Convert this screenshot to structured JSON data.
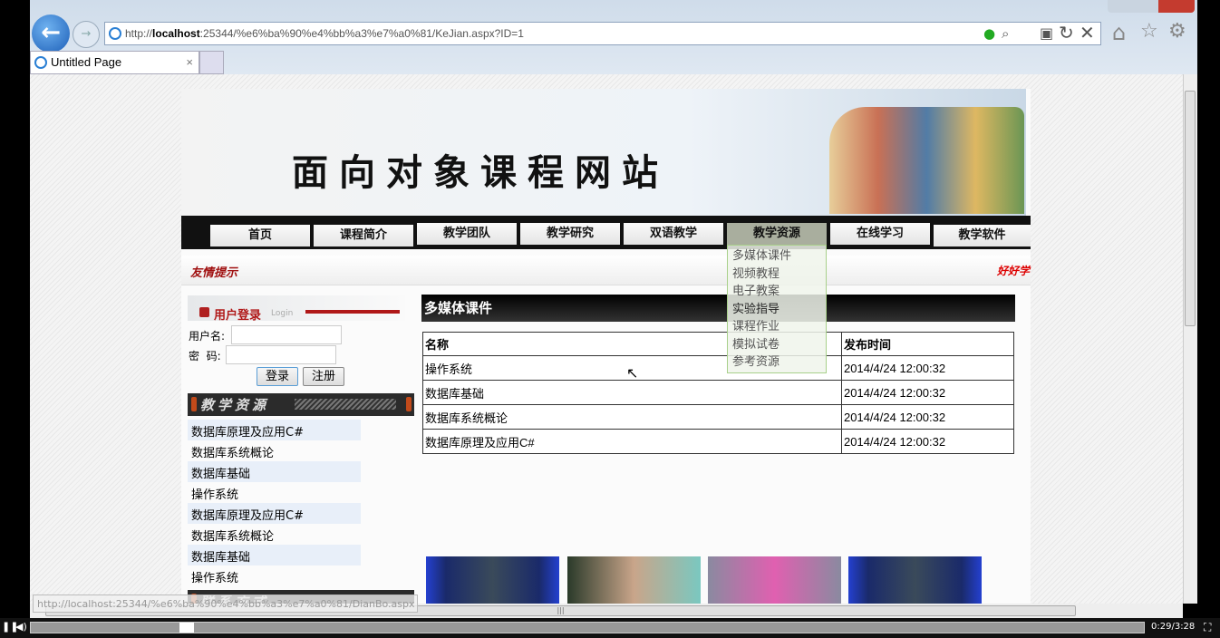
{
  "browser": {
    "url_prefix": "http://",
    "url_host": "localhost",
    "url_rest": ":25344/%e6%ba%90%e4%bb%a3%e7%a0%81/KeJian.aspx?ID=1",
    "tab_title": "Untitled Page",
    "tab_close": "×",
    "status_url": "http://localhost:25344/%e6%ba%90%e4%bb%a3%e7%a0%81/DianBo.aspx"
  },
  "banner": {
    "title": "面向对象课程网站"
  },
  "nav": {
    "items": [
      "首页",
      "课程简介",
      "教学团队",
      "教学研究",
      "双语教学",
      "教学资源",
      "在线学习",
      "教学软件"
    ],
    "active": "教学资源"
  },
  "dropdown": {
    "items": [
      "多媒体课件",
      "视频教程",
      "电子教案",
      "实验指导",
      "课程作业",
      "模拟试卷",
      "参考资源"
    ],
    "highlighted": "实验指导"
  },
  "tip": {
    "left": "友情提示",
    "right": "好好学"
  },
  "login": {
    "title": "用户登录",
    "subtitle": "Login",
    "username_label": "用户名:",
    "password_label": "密  码:",
    "username_value": "",
    "password_value": "",
    "login_button": "登录",
    "register_button": "注册"
  },
  "resources": {
    "title": "教学资源",
    "items": [
      "数据库原理及应用C#",
      "数据库系统概论",
      "数据库基础",
      "操作系统",
      "数据库原理及应用C#",
      "数据库系统概论",
      "数据库基础",
      "操作系统"
    ]
  },
  "contact": {
    "title": "联系方式"
  },
  "main": {
    "title": "多媒体课件",
    "columns": [
      "名称",
      "发布时间"
    ],
    "rows": [
      [
        "操作系统",
        "2014/4/24 12:00:32"
      ],
      [
        "数据库基础",
        "2014/4/24 12:00:32"
      ],
      [
        "数据库系统概论",
        "2014/4/24 12:00:32"
      ],
      [
        "数据库原理及应用C#",
        "2014/4/24 12:00:32"
      ]
    ]
  },
  "player": {
    "time": "0:29/3:28",
    "progress": 0.14
  }
}
